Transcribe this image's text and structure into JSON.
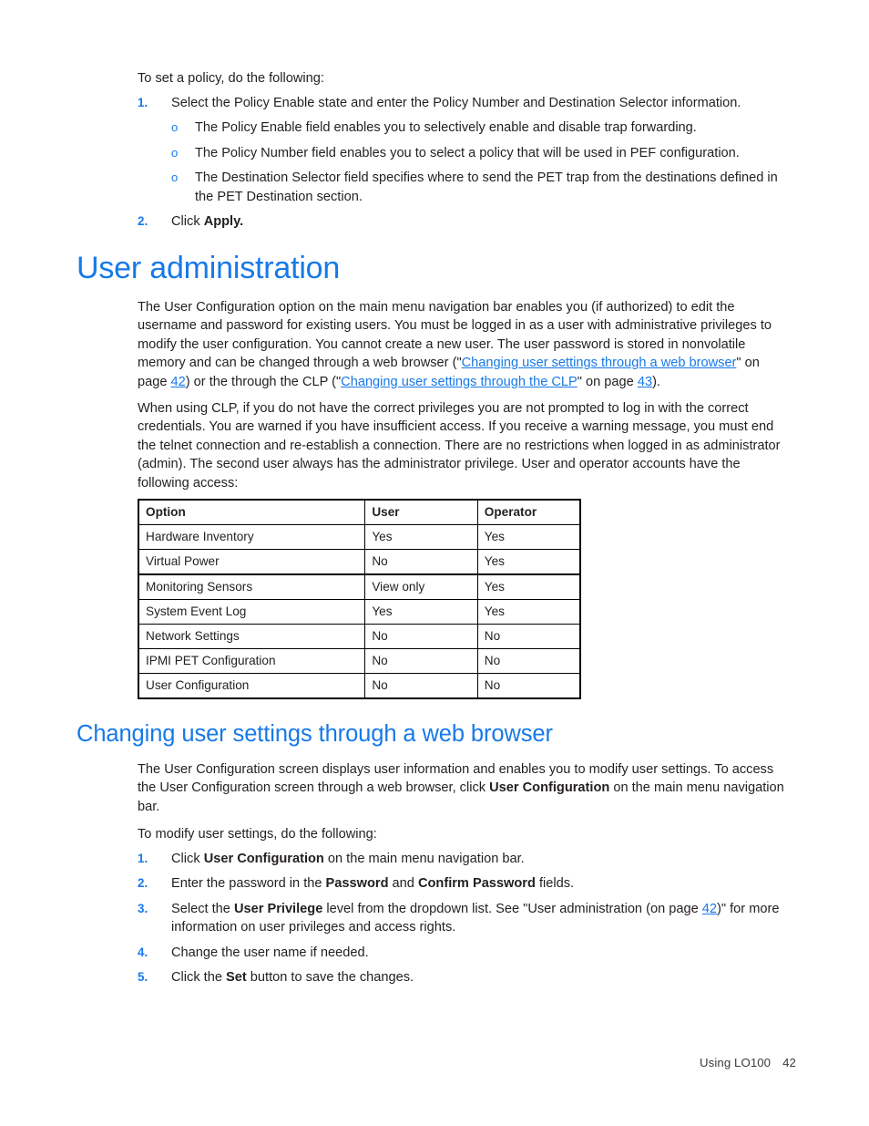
{
  "document": {
    "footer": {
      "label": "Using LO100",
      "page_number": "42"
    },
    "colors": {
      "heading_blue": "#1779e8",
      "link_blue": "#1779e8",
      "body_text": "#231f20"
    }
  },
  "intro": {
    "lead": "To set a policy, do the following:",
    "steps": [
      {
        "marker": "1.",
        "text": "Select the Policy Enable state and enter the Policy Number and Destination Selector information.",
        "sub": [
          {
            "marker": "o",
            "text": "The Policy Enable field enables you to selectively enable and disable trap forwarding."
          },
          {
            "marker": "o",
            "text": "The Policy Number field enables you to select a policy that will be used in PEF configuration."
          },
          {
            "marker": "o",
            "text": "The Destination Selector field specifies where to send the PET trap from the destinations defined in the PET Destination section."
          }
        ]
      },
      {
        "marker": "2.",
        "text_prefix": "Click ",
        "text_bold": "Apply.",
        "text_suffix": ""
      }
    ]
  },
  "section_user_admin": {
    "heading": "User administration",
    "para1": {
      "seg1": "The User Configuration option on the main menu navigation bar enables you (if authorized) to edit the username and password for existing users. You must be logged in as a user with administrative privileges to modify the user configuration. You cannot create a new user. The user password is stored in nonvolatile memory and can be changed through a web browser (\"",
      "link1": "Changing user settings through a web browser",
      "seg2": "\" on page ",
      "link_page1": "42",
      "seg3": ") or the through the CLP (\"",
      "link2": "Changing user settings through the CLP",
      "seg4": "\" on page ",
      "link_page2": "43",
      "seg5": ")."
    },
    "para2": "When using CLP, if you do not have the correct privileges you are not prompted to log in with the correct credentials. You are warned if you have insufficient access. If you receive a warning message, you must end the telnet connection and re-establish a connection. There are no restrictions when logged in as administrator (admin). The second user always has the administrator privilege. User and operator accounts have the following access:",
    "table": {
      "headers": [
        "Option",
        "User",
        "Operator"
      ],
      "rows": [
        {
          "option": "Hardware Inventory",
          "user": "Yes",
          "operator": "Yes"
        },
        {
          "option": "Virtual Power",
          "user": "No",
          "operator": "Yes"
        },
        {
          "option": "Monitoring Sensors",
          "user": "View only",
          "operator": "Yes"
        },
        {
          "option": "System Event Log",
          "user": "Yes",
          "operator": "Yes"
        },
        {
          "option": "Network Settings",
          "user": "No",
          "operator": "No"
        },
        {
          "option": "IPMI PET Configuration",
          "user": "No",
          "operator": "No"
        },
        {
          "option": "User Configuration",
          "user": "No",
          "operator": "No"
        }
      ]
    }
  },
  "section_web_browser": {
    "heading": "Changing user settings through a web browser",
    "para1": {
      "seg1": "The User Configuration screen displays user information and enables you to modify user settings. To access the User Configuration screen through a web browser, click ",
      "bold1": "User Configuration",
      "seg2": " on the main menu navigation bar."
    },
    "lead": "To modify user settings, do the following:",
    "steps": [
      {
        "marker": "1.",
        "seg1": "Click ",
        "bold1": "User Configuration",
        "seg2": " on the main menu navigation bar."
      },
      {
        "marker": "2.",
        "seg1": "Enter the password in the ",
        "bold1": "Password",
        "seg2": " and ",
        "bold2": "Confirm Password",
        "seg3": " fields."
      },
      {
        "marker": "3.",
        "seg1": "Select the ",
        "bold1": "User Privilege",
        "seg2": " level from the dropdown list. See \"User administration (on page ",
        "link_page": "42",
        "seg3": ")\" for more information on user privileges and access rights."
      },
      {
        "marker": "4.",
        "seg1": "Change the user name if needed."
      },
      {
        "marker": "5.",
        "seg1": "Click the ",
        "bold1": "Set",
        "seg2": " button to save the changes."
      }
    ]
  }
}
